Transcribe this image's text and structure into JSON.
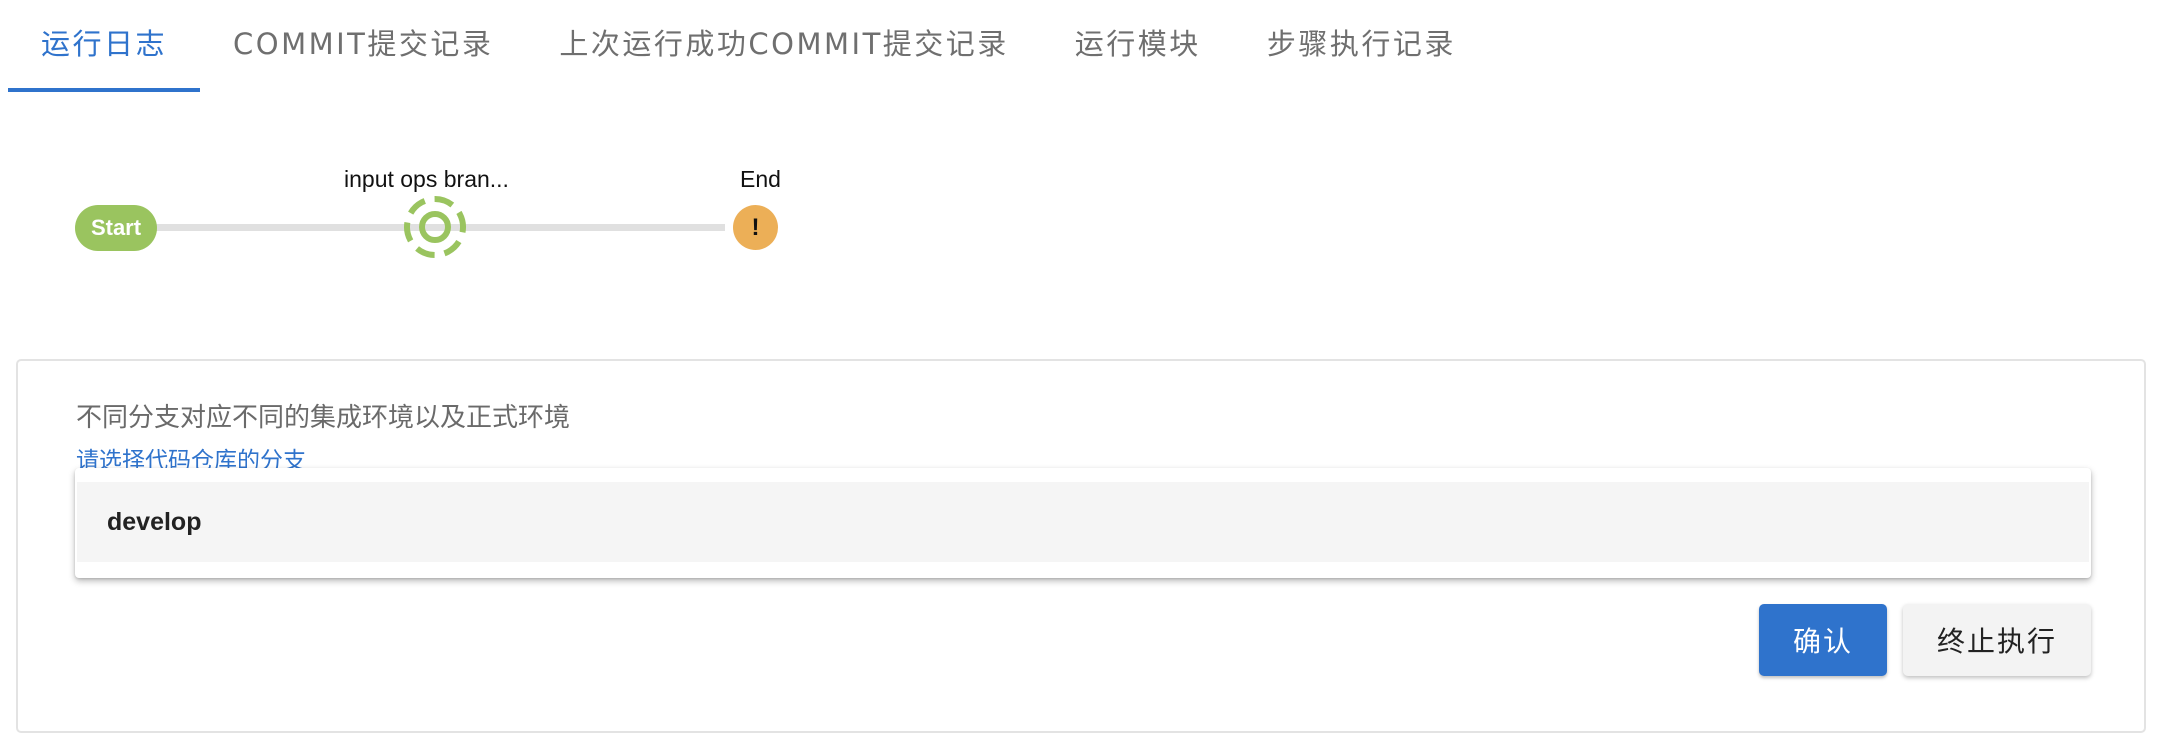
{
  "tabs": [
    {
      "label": "运行日志",
      "active": true
    },
    {
      "label": "COMMIT提交记录",
      "active": false
    },
    {
      "label": "上次运行成功COMMIT提交记录",
      "active": false
    },
    {
      "label": "运行模块",
      "active": false
    },
    {
      "label": "步骤执行记录",
      "active": false
    }
  ],
  "pipeline": {
    "start_label": "Start",
    "stages": [
      {
        "label": "input ops bran...",
        "status": "running"
      },
      {
        "label": "End",
        "status": "warning"
      }
    ],
    "warning_symbol": "!",
    "colors": {
      "success": "#9ac45f",
      "warning": "#ecaf57",
      "line": "#e0e0e0"
    }
  },
  "input_step": {
    "description": "不同分支对应不同的集成环境以及正式环境",
    "hint": "请选择代码仓库的分支",
    "selected_branch": "develop",
    "confirm_label": "确认",
    "stop_label": "终止执行"
  },
  "accent_color": "#2f73cc"
}
